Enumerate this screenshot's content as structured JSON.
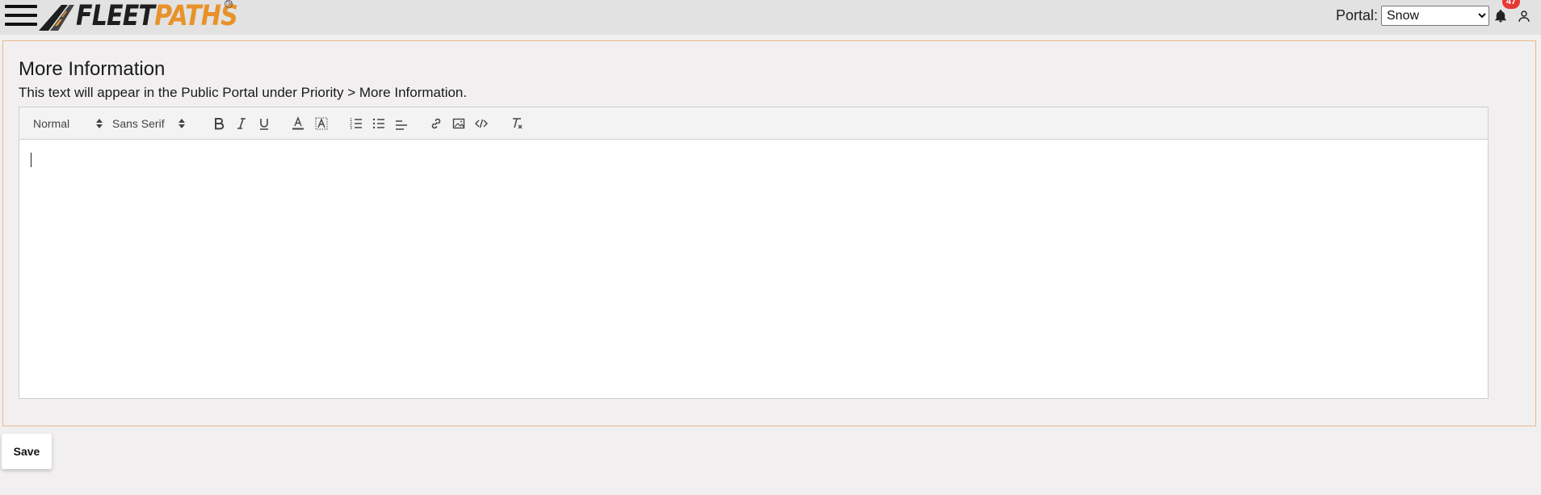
{
  "header": {
    "logo_text_dark": "FLEET",
    "logo_text_orange": "PATHS",
    "logo_tm": "TM",
    "portal_label": "Portal:",
    "portal_selected": "Snow",
    "portal_options": [
      "Snow"
    ],
    "notification_count": "47",
    "brand_orange": "#e8922a",
    "badge_color": "#e53935"
  },
  "section": {
    "title": "More Information",
    "description": "This text will appear in the Public Portal under Priority > More Information."
  },
  "editor": {
    "header_picker": "Normal",
    "font_picker": "Sans Serif",
    "icons": [
      "bold-icon",
      "italic-icon",
      "underline-icon",
      "text-color-icon",
      "background-color-icon",
      "ordered-list-icon",
      "bullet-list-icon",
      "align-icon",
      "link-icon",
      "image-icon",
      "code-icon",
      "clear-format-icon"
    ],
    "content": ""
  },
  "actions": {
    "save_label": "Save"
  }
}
